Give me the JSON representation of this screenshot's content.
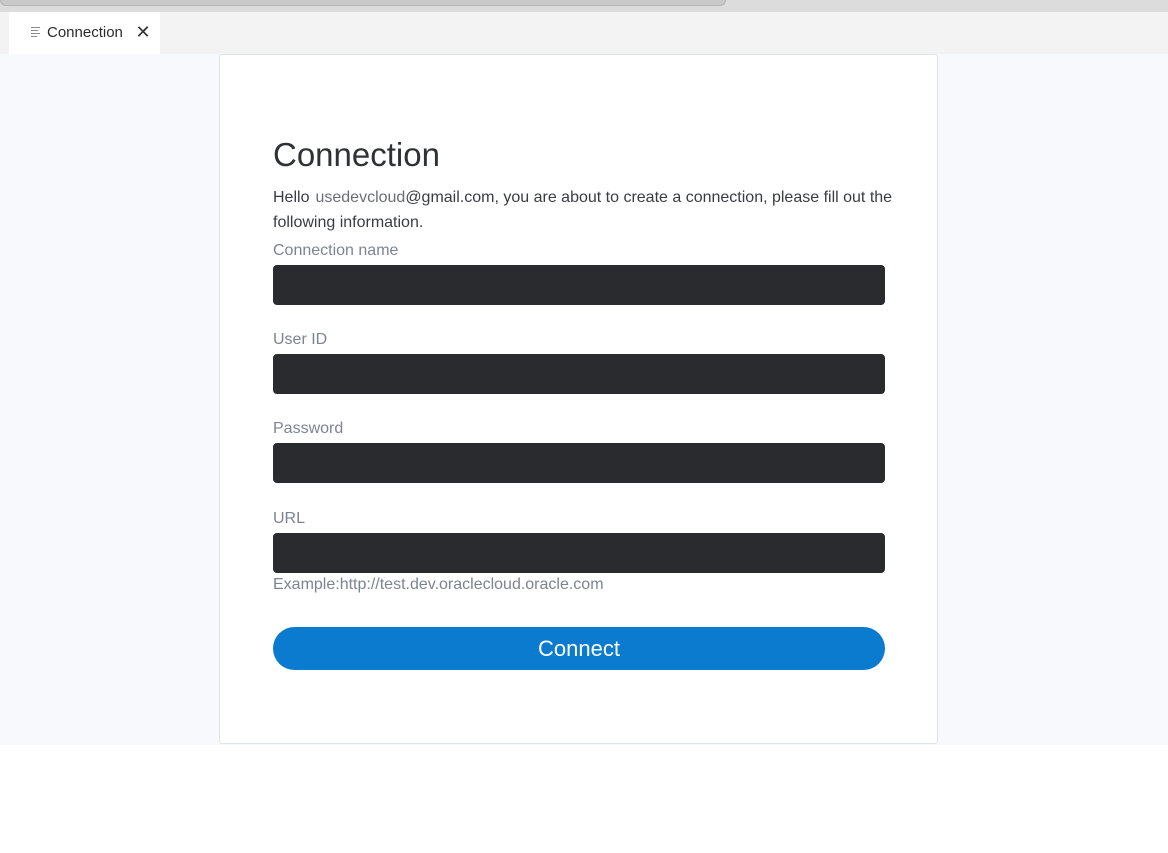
{
  "tab": {
    "label": "Connection",
    "close_symbol": "✕",
    "icon": "document-lines-icon"
  },
  "form": {
    "title": "Connection",
    "intro_prefix": "Hello",
    "user_name": "usedevcloud",
    "intro_suffix": "@gmail.com, you are about to create a connection, please fill out the following information.",
    "fields": [
      {
        "label": "Connection name",
        "value": ""
      },
      {
        "label": "User ID",
        "value": ""
      },
      {
        "label": "Password",
        "value": ""
      },
      {
        "label": "URL",
        "value": ""
      }
    ],
    "url_example": "Example:http://test.dev.oraclecloud.oracle.com",
    "submit_label": "Connect"
  },
  "colors": {
    "accent": "#0b7bd0",
    "input_bg": "#2a2b2e",
    "page_bg": "#f7f9fd",
    "label": "#7c8494"
  }
}
